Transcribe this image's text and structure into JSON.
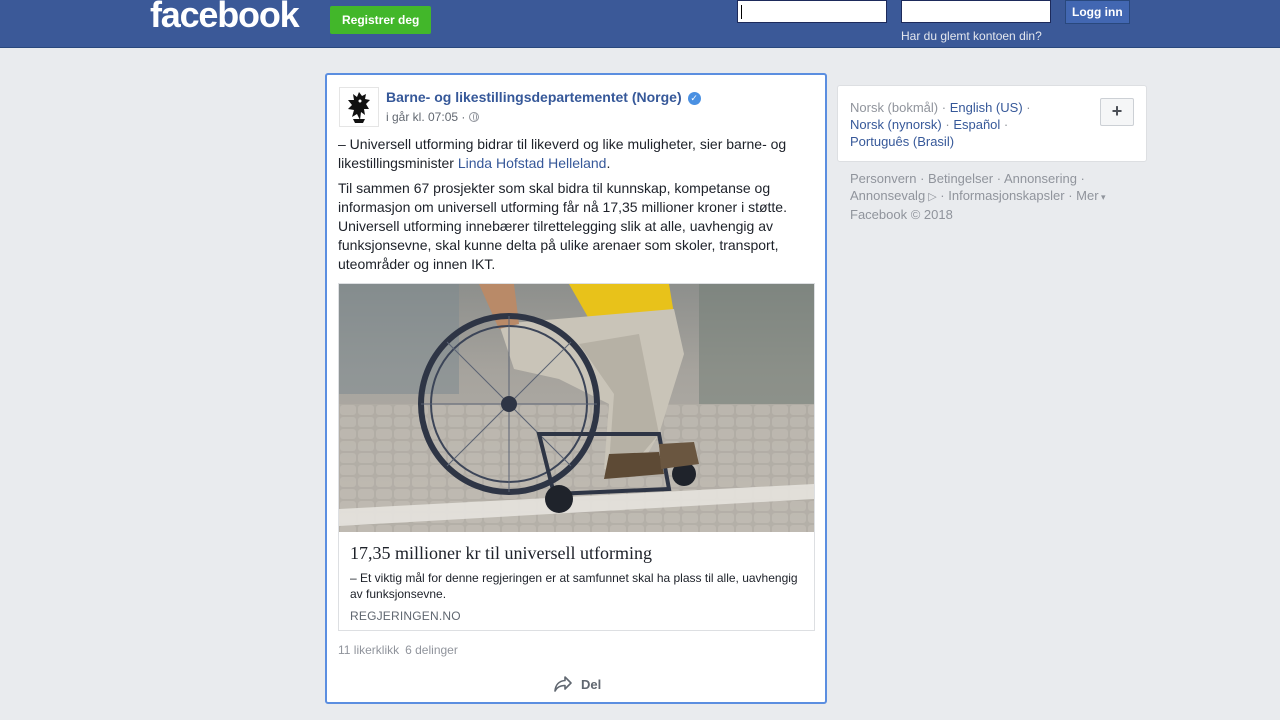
{
  "header": {
    "logo": "facebook",
    "register_label": "Registrer deg",
    "login_label": "Logg inn",
    "forgot_label": "Har du glemt kontoen din?",
    "email_value": "",
    "password_value": ""
  },
  "post": {
    "page_name": "Barne- og likestillingsdepartementet (Norge)",
    "time": "i går kl. 07:05 ·",
    "text1_part1": "– Universell utforming bidrar til likeverd og like muligheter, sier barne- og likestillingsminister ",
    "text1_link": "Linda Hofstad Helleland",
    "text1_part2": ".",
    "text2": "Til sammen 67 prosjekter som skal bidra til kunnskap, kompetanse og informasjon om universell utforming får nå 17,35 millioner kroner i støtte. Universell utforming innebærer tilrettelegging slik at alle, uavhengig av funksjonsevne, skal kunne delta på ulike arenaer som skoler, transport, uteområder og innen IKT.",
    "preview_title": "17,35 millioner kr til universell utforming",
    "preview_desc": "– Et viktig mål for denne regjeringen er at samfunnet skal ha plass til alle, uavhengig av funksjonsevne.",
    "preview_domain": "REGJERINGEN.NO",
    "likes": "11 likerklikk",
    "shares": "6 delinger",
    "share_label": "Del"
  },
  "sidebar": {
    "current_language": "Norsk (bokmål)",
    "languages": [
      "English (US)",
      "Norsk (nynorsk)",
      "Español",
      "Português (Brasil)"
    ],
    "add_label": "+",
    "footer_links": [
      "Personvern",
      "Betingelser",
      "Annonsering",
      "Annonsevalg",
      "Informasjonskapsler",
      "Mer"
    ],
    "copyright": "Facebook © 2018"
  },
  "colors": {
    "brand_blue": "#3b5998",
    "register_green": "#42b72a",
    "link_blue": "#365899",
    "focus_border": "#5b8ee0"
  }
}
